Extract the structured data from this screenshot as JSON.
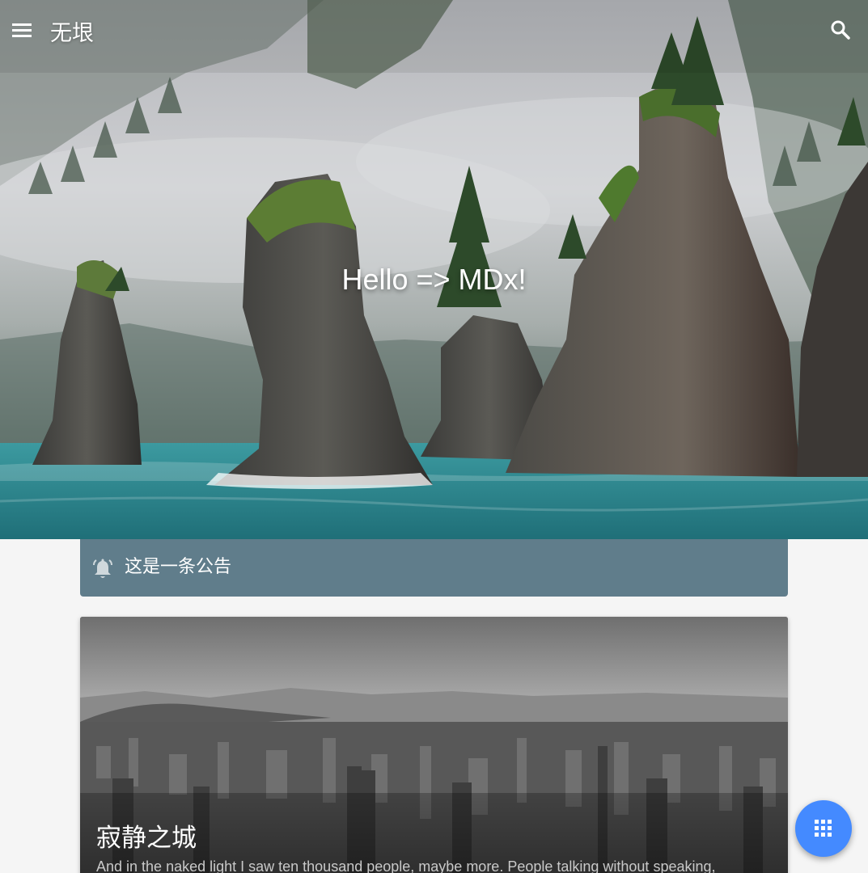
{
  "header": {
    "site_title": "无垠",
    "menu_icon": "menu-icon",
    "search_icon": "search-icon"
  },
  "hero": {
    "title": "Hello => MDx!"
  },
  "notice": {
    "icon": "bell-icon",
    "text": "这是一条公告"
  },
  "posts": [
    {
      "title": "寂静之城",
      "excerpt": "And in the naked light I saw ten thousand people, maybe more. People talking without speaking,"
    }
  ],
  "fab": {
    "icon": "apps-grid-icon"
  },
  "colors": {
    "notice_bg": "#607d8b",
    "fab_bg": "#448aff",
    "page_bg": "#f5f5f5"
  }
}
